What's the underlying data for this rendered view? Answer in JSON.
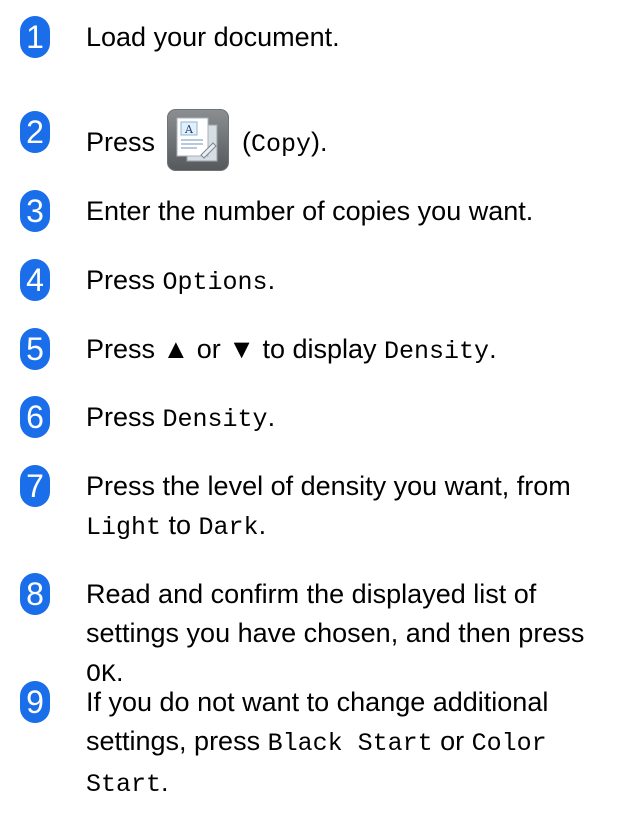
{
  "steps": [
    {
      "num": "1",
      "parts": [
        {
          "text": "Load your document."
        }
      ]
    },
    {
      "num": "2",
      "parts": [
        {
          "text": "Press "
        },
        {
          "icon": "copy-icon"
        },
        {
          "text": " ("
        },
        {
          "mono": "Copy"
        },
        {
          "text": ")."
        }
      ]
    },
    {
      "num": "3",
      "parts": [
        {
          "text": "Enter the number of copies you want."
        }
      ]
    },
    {
      "num": "4",
      "parts": [
        {
          "text": "Press "
        },
        {
          "mono": "Options"
        },
        {
          "text": "."
        }
      ]
    },
    {
      "num": "5",
      "parts": [
        {
          "text": "Press ▲ or ▼ to display "
        },
        {
          "mono": "Density"
        },
        {
          "text": "."
        }
      ]
    },
    {
      "num": "6",
      "parts": [
        {
          "text": "Press "
        },
        {
          "mono": "Density"
        },
        {
          "text": "."
        }
      ]
    },
    {
      "num": "7",
      "parts": [
        {
          "text": "Press the level of density you want, from "
        },
        {
          "mono": "Light"
        },
        {
          "text": " to "
        },
        {
          "mono": "Dark"
        },
        {
          "text": "."
        }
      ]
    },
    {
      "num": "8",
      "parts": [
        {
          "text": "Read and confirm the displayed list of settings you have chosen, and then press "
        },
        {
          "mono": "OK"
        },
        {
          "text": "."
        }
      ]
    },
    {
      "num": "9",
      "parts": [
        {
          "text": "If you do not want to change additional settings, press "
        },
        {
          "mono": "Black Start"
        },
        {
          "text": " or "
        },
        {
          "mono": "Color Start"
        },
        {
          "text": "."
        }
      ]
    }
  ]
}
